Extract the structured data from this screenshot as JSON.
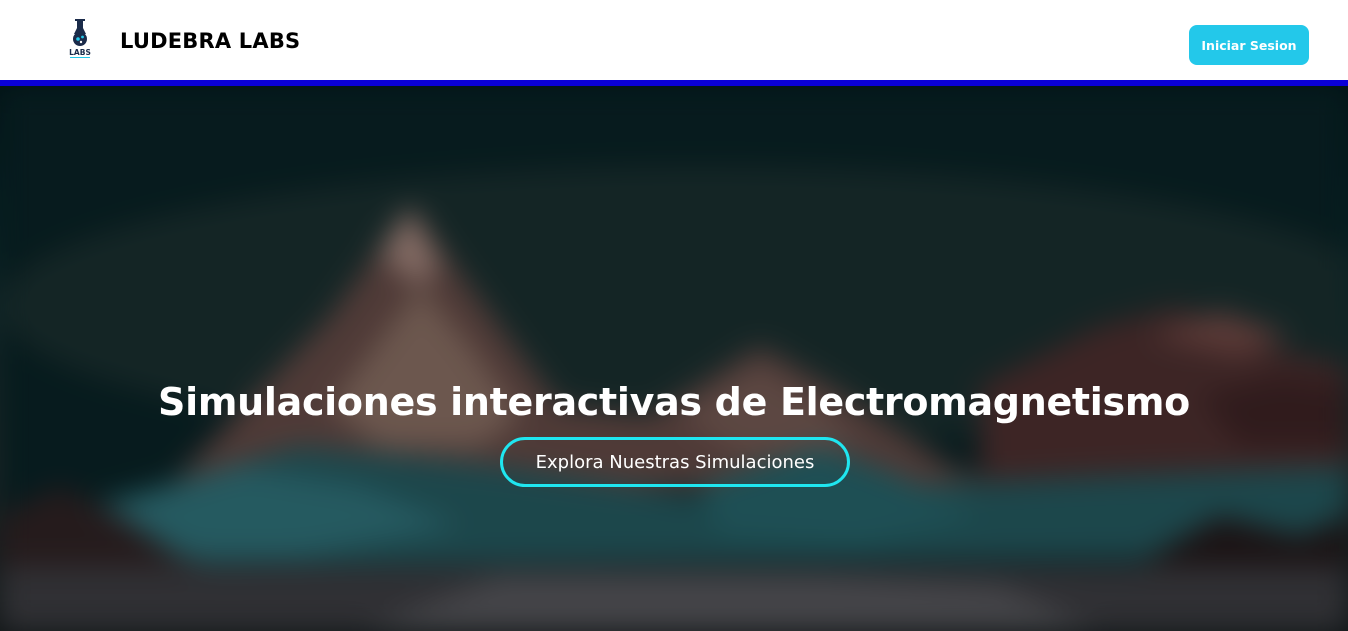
{
  "header": {
    "logo_text": "LABS",
    "brand": "LUDEBRA LABS",
    "login_label": "Iniciar Sesion"
  },
  "hero": {
    "title": "Simulaciones interactivas de Electromagnetismo",
    "cta_label": "Explora Nuestras Simulaciones"
  },
  "colors": {
    "accent": "#23c8ea",
    "nav_border": "#0a00d8",
    "cta_border": "#1fe6f0"
  }
}
